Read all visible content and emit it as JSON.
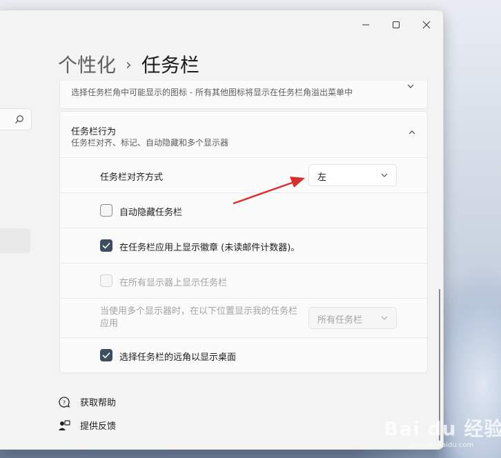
{
  "breadcrumb": {
    "parent": "个性化",
    "separator": "›",
    "current": "任务栏"
  },
  "top_card": {
    "description": "选择任务栏角中可能显示的图标 - 所有其他图标将显示在任务栏角溢出菜单中"
  },
  "behavior": {
    "title": "任务栏行为",
    "subtitle": "任务栏对齐、标记、自动隐藏和多个显示器",
    "alignment": {
      "label": "任务栏对齐方式",
      "value": "左"
    },
    "autohide": {
      "label": "自动隐藏任务栏",
      "checked": false
    },
    "badges": {
      "label": "在任务栏应用上显示徽章 (未读邮件计数器)。",
      "checked": true
    },
    "all_displays": {
      "label": "在所有显示器上显示任务栏",
      "checked": false,
      "disabled": true
    },
    "multi_display": {
      "label": "当使用多个显示器时，在以下位置显示我的任务栏应用",
      "value": "所有任务栏"
    },
    "far_corner": {
      "label": "选择任务栏的远角以显示桌面",
      "checked": true
    }
  },
  "footer": {
    "help": "获取帮助",
    "feedback": "提供反馈"
  },
  "watermark": {
    "brand": "Bai du 经验",
    "url": "jingyan.baidu.com"
  },
  "colors": {
    "accent": "#3c4e62",
    "arrow": "#d9302b"
  }
}
